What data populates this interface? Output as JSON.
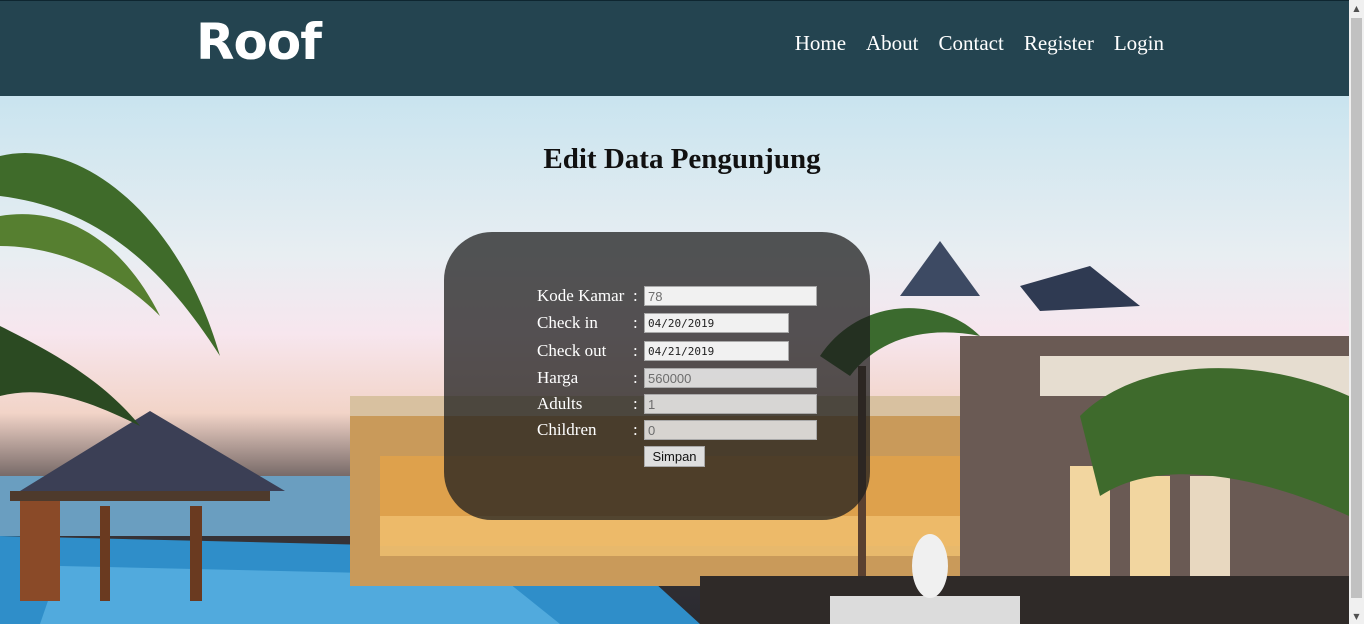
{
  "brand": {
    "logo": "Roof"
  },
  "nav": {
    "items": [
      {
        "label": "Home"
      },
      {
        "label": "About"
      },
      {
        "label": "Contact"
      },
      {
        "label": "Register"
      },
      {
        "label": "Login"
      }
    ]
  },
  "page": {
    "title": "Edit Data Pengunjung"
  },
  "form": {
    "fields": [
      {
        "label": "Kode Kamar",
        "colon": ":",
        "value": "78"
      },
      {
        "label": "Check in",
        "colon": ":",
        "value": "04/20/2019"
      },
      {
        "label": "Check out",
        "colon": ":",
        "value": "04/21/2019"
      },
      {
        "label": "Harga",
        "colon": ":",
        "value": "560000"
      },
      {
        "label": "Adults",
        "colon": ":",
        "value": "1"
      },
      {
        "label": "Children",
        "colon": ":",
        "value": "0"
      }
    ],
    "submit_label": "Simpan"
  },
  "scrollbar": {
    "up_icon": "▲",
    "down_icon": "▼"
  },
  "colors": {
    "navbar": "#244450",
    "panel": "rgba(30,30,30,0.75)",
    "text_light": "#ffffff"
  }
}
